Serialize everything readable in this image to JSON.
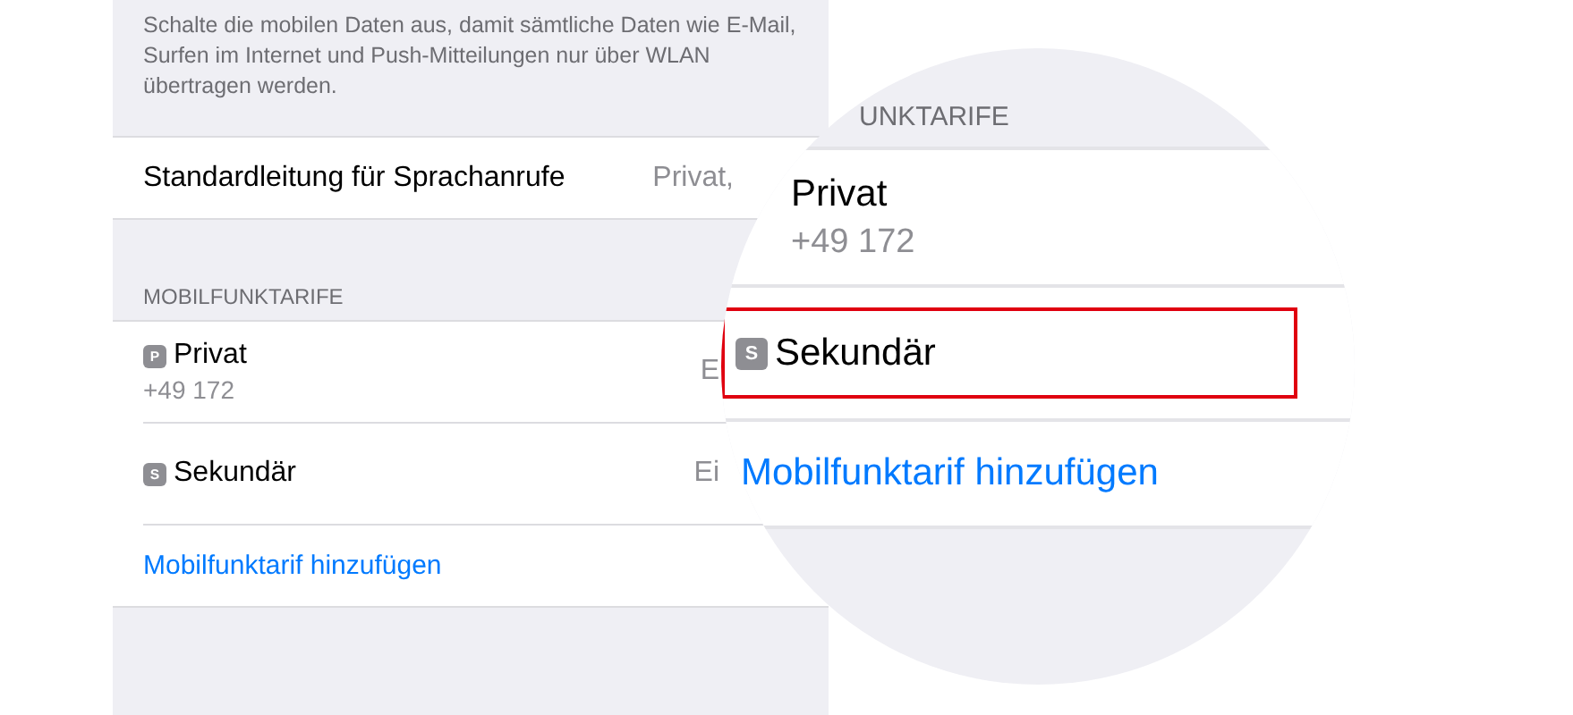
{
  "settings": {
    "description": "Schalte die mobilen Daten aus, damit sämtliche Daten wie E-Mail, Surfen im Internet und Push-Mitteilungen nur über WLAN übertragen werden.",
    "voice_row": {
      "label": "Standardleitung für Sprachanrufe",
      "value": "Privat,"
    },
    "section_header": "MOBILFUNKTARIFE",
    "plans": [
      {
        "badge": "P",
        "name": "Privat",
        "number": "+49 172",
        "value": "E"
      },
      {
        "badge": "S",
        "name": "Sekundär",
        "value": "Ei"
      }
    ],
    "add_link": "Mobilfunktarif hinzufügen"
  },
  "magnifier": {
    "section_header": "UNKTARIFE",
    "plans": [
      {
        "name": "Privat",
        "number": "+49 172",
        "highlighted": false
      },
      {
        "badge": "S",
        "name": "Sekundär",
        "highlighted": true
      }
    ],
    "add_link": "Mobilfunktarif hinzufügen"
  }
}
